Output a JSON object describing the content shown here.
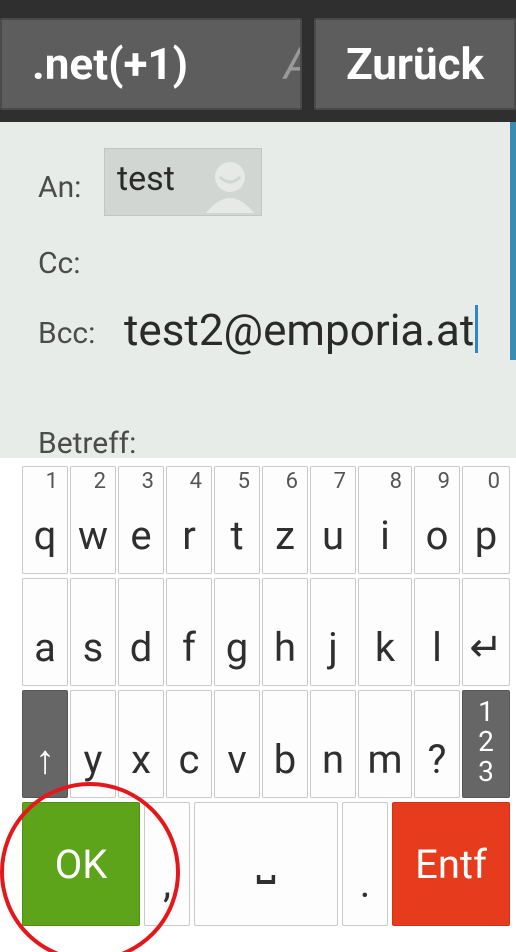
{
  "topbar": {
    "left_button": ".net(+1)",
    "left_ghost": "A",
    "right_button": "Zurück"
  },
  "compose": {
    "to_label": "An:",
    "to_chip": "test",
    "cc_label": "Cc:",
    "bcc_label": "Bcc:",
    "bcc_value": "test2@emporia.at",
    "subject_label": "Betreff:"
  },
  "keyboard": {
    "row1": [
      {
        "char": "q",
        "num": "1"
      },
      {
        "char": "w",
        "num": "2"
      },
      {
        "char": "e",
        "num": "3"
      },
      {
        "char": "r",
        "num": "4"
      },
      {
        "char": "t",
        "num": "5"
      },
      {
        "char": "z",
        "num": "6"
      },
      {
        "char": "u",
        "num": "7"
      },
      {
        "char": "i",
        "num": "8"
      },
      {
        "char": "o",
        "num": "9"
      },
      {
        "char": "p",
        "num": "0"
      }
    ],
    "row2": [
      "a",
      "s",
      "d",
      "f",
      "g",
      "h",
      "j",
      "k",
      "l",
      "↵"
    ],
    "row3": [
      "↑",
      "y",
      "x",
      "c",
      "v",
      "b",
      "n",
      "m",
      "?",
      "1 2 3"
    ],
    "bottom": {
      "ok": "OK",
      "comma": ",",
      "space": "⎵",
      "dot": ".",
      "delete": "Entf"
    }
  },
  "colors": {
    "ok_green": "#5ea41b",
    "delete_red": "#e73b1e",
    "accent_blue": "#3a8db1"
  }
}
